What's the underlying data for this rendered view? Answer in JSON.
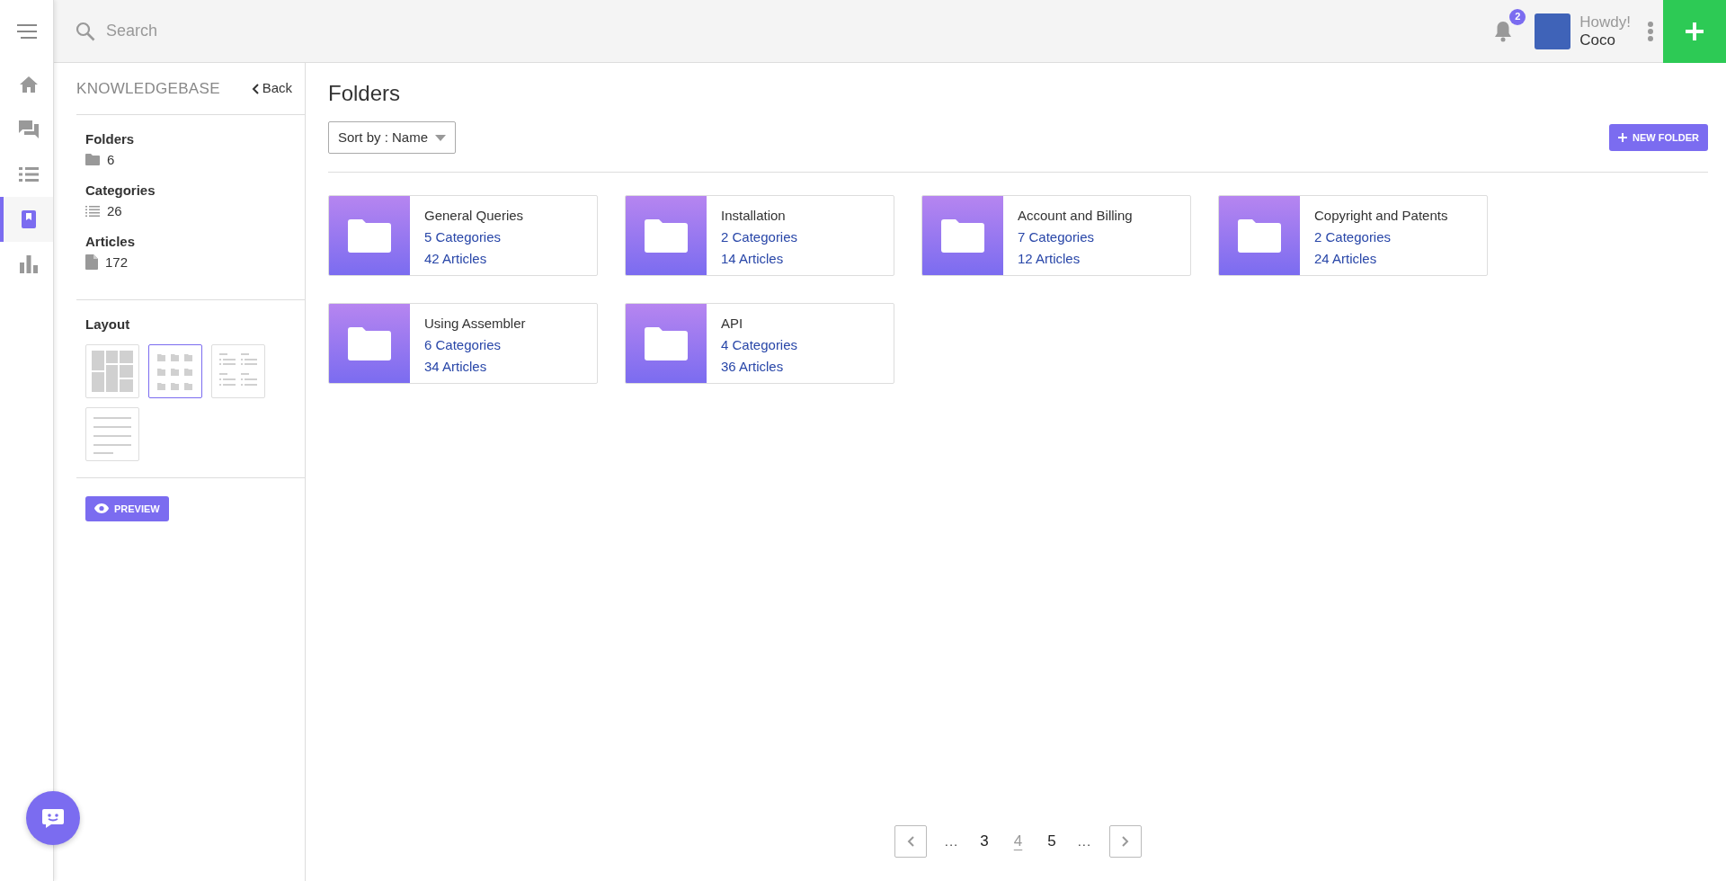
{
  "rail": {
    "items": [
      {
        "kind": "home",
        "selected": false
      },
      {
        "kind": "chat",
        "selected": false
      },
      {
        "kind": "list",
        "selected": false
      },
      {
        "kind": "book",
        "selected": true
      },
      {
        "kind": "chart",
        "selected": false
      }
    ]
  },
  "topbar": {
    "search": {
      "placeholder": "Search"
    },
    "notifications": "2",
    "greeting": "Howdy!",
    "user": "Coco"
  },
  "sidebar": {
    "title": "KNOWLEDGEBASE",
    "back": "Back",
    "stats": [
      {
        "kind": "folder",
        "label": "Folders",
        "value": "6"
      },
      {
        "kind": "list",
        "label": "Categories",
        "value": "26"
      },
      {
        "kind": "file",
        "label": "Articles",
        "value": "172"
      }
    ],
    "layout_label": "Layout",
    "layouts": [
      {
        "kind": "masonry",
        "selected": false
      },
      {
        "kind": "grid",
        "selected": true
      },
      {
        "kind": "columns",
        "selected": false
      },
      {
        "kind": "lines",
        "selected": false
      }
    ],
    "preview": "PREVIEW"
  },
  "main": {
    "title": "Folders",
    "sort": "Sort by : Name",
    "new_folder": "NEW FOLDER",
    "folders": [
      {
        "name": "General Queries",
        "categories": "5 Categories",
        "articles": "42 Articles"
      },
      {
        "name": "Installation",
        "categories": "2 Categories",
        "articles": "14 Articles"
      },
      {
        "name": "Account and Billing",
        "categories": "7 Categories",
        "articles": "12 Articles"
      },
      {
        "name": "Copyright and Patents",
        "categories": "2 Categories",
        "articles": "24 Articles"
      },
      {
        "name": "Using Assembler",
        "categories": "6 Categories",
        "articles": "34 Articles"
      },
      {
        "name": "API",
        "categories": "4 Categories",
        "articles": "36 Articles"
      }
    ],
    "pagination": [
      {
        "label": "...",
        "kind": "ellipsis",
        "selected": false
      },
      {
        "label": "3",
        "kind": "page",
        "selected": false
      },
      {
        "label": "4",
        "kind": "page",
        "selected": true
      },
      {
        "label": "5",
        "kind": "page",
        "selected": false
      },
      {
        "label": "...",
        "kind": "ellipsis",
        "selected": false
      }
    ]
  }
}
